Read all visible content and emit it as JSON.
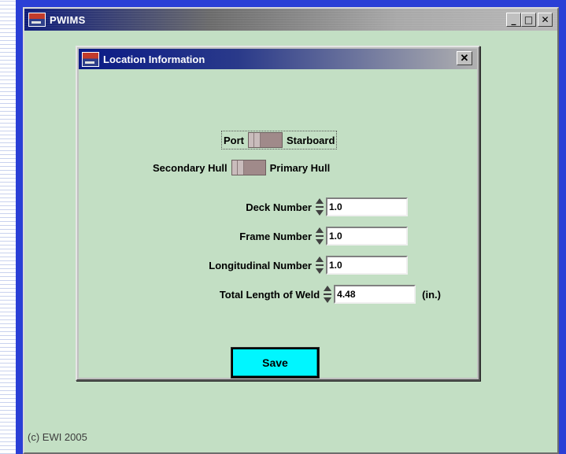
{
  "main_window": {
    "title": "PWIMS",
    "minimize_glyph": "_",
    "maximize_glyph": "□",
    "close_glyph": "✕",
    "footer": "(c) EWI 2005"
  },
  "dialog": {
    "title": "Location Information",
    "close_glyph": "✕",
    "side_toggle": {
      "left_label": "Port",
      "right_label": "Starboard"
    },
    "hull_toggle": {
      "left_label": "Secondary Hull",
      "right_label": "Primary Hull"
    },
    "fields": [
      {
        "label": "Deck Number",
        "value": "1.0",
        "unit": ""
      },
      {
        "label": "Frame Number",
        "value": "1.0",
        "unit": ""
      },
      {
        "label": "Longitudinal Number",
        "value": "1.0",
        "unit": ""
      },
      {
        "label": "Total Length of Weld",
        "value": "4.48",
        "unit": "(in.)"
      }
    ],
    "save_label": "Save"
  },
  "colors": {
    "client_background": "#c3dfc4",
    "save_button": "#00f6ff",
    "toggle": "#a08a8a",
    "main_frame": "#2a3fd6"
  },
  "icons": [
    "app-icon",
    "minimize-icon",
    "maximize-icon",
    "close-icon",
    "spinner-up-icon",
    "spinner-down-icon"
  ]
}
